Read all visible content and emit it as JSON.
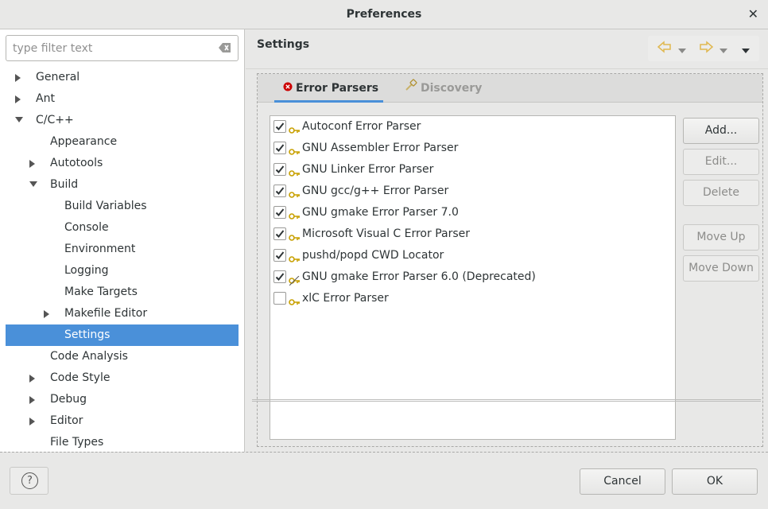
{
  "window": {
    "title": "Preferences"
  },
  "filter": {
    "placeholder": "type filter text"
  },
  "tree": [
    {
      "label": "General",
      "level": 0,
      "arrow": "right"
    },
    {
      "label": "Ant",
      "level": 0,
      "arrow": "right"
    },
    {
      "label": "C/C++",
      "level": 0,
      "arrow": "down"
    },
    {
      "label": "Appearance",
      "level": 1,
      "arrow": "none"
    },
    {
      "label": "Autotools",
      "level": 1,
      "arrow": "right"
    },
    {
      "label": "Build",
      "level": 1,
      "arrow": "down"
    },
    {
      "label": "Build Variables",
      "level": 2,
      "arrow": "none"
    },
    {
      "label": "Console",
      "level": 2,
      "arrow": "none"
    },
    {
      "label": "Environment",
      "level": 2,
      "arrow": "none"
    },
    {
      "label": "Logging",
      "level": 2,
      "arrow": "none"
    },
    {
      "label": "Make Targets",
      "level": 2,
      "arrow": "none"
    },
    {
      "label": "Makefile Editor",
      "level": 2,
      "arrow": "right"
    },
    {
      "label": "Settings",
      "level": 2,
      "arrow": "none",
      "selected": true
    },
    {
      "label": "Code Analysis",
      "level": 1,
      "arrow": "none"
    },
    {
      "label": "Code Style",
      "level": 1,
      "arrow": "right"
    },
    {
      "label": "Debug",
      "level": 1,
      "arrow": "right"
    },
    {
      "label": "Editor",
      "level": 1,
      "arrow": "right"
    },
    {
      "label": "File Types",
      "level": 1,
      "arrow": "none"
    }
  ],
  "page": {
    "title": "Settings"
  },
  "tabs": {
    "error_parsers": "Error Parsers",
    "discovery": "Discovery"
  },
  "parsers": [
    {
      "label": "Autoconf Error Parser",
      "checked": true,
      "deprecated": false
    },
    {
      "label": "GNU Assembler Error Parser",
      "checked": true,
      "deprecated": false
    },
    {
      "label": "GNU Linker Error Parser",
      "checked": true,
      "deprecated": false
    },
    {
      "label": "GNU gcc/g++ Error Parser",
      "checked": true,
      "deprecated": false
    },
    {
      "label": "GNU gmake Error Parser 7.0",
      "checked": true,
      "deprecated": false
    },
    {
      "label": "Microsoft Visual C Error Parser",
      "checked": true,
      "deprecated": false
    },
    {
      "label": "pushd/popd CWD Locator",
      "checked": true,
      "deprecated": false
    },
    {
      "label": "GNU gmake Error Parser 6.0 (Deprecated)",
      "checked": true,
      "deprecated": true
    },
    {
      "label": "xlC Error Parser",
      "checked": false,
      "deprecated": false
    }
  ],
  "side_buttons": {
    "add": "Add...",
    "edit": "Edit...",
    "delete": "Delete",
    "move_up": "Move Up",
    "move_down": "Move Down"
  },
  "footer": {
    "help": "?",
    "cancel": "Cancel",
    "ok": "OK"
  },
  "colors": {
    "selection": "#4a90d9",
    "key_icon": "#c8a000",
    "nav_arrow": "#e8c56a",
    "error_icon": "#cc0000"
  }
}
